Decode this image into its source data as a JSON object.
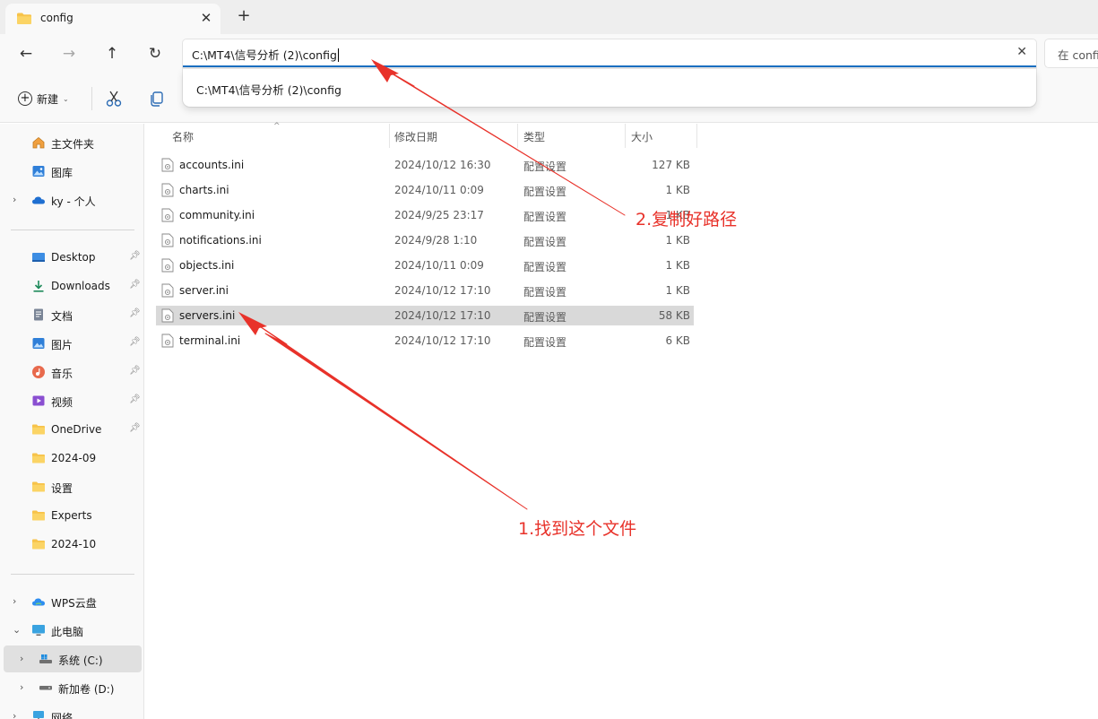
{
  "window": {
    "tab_title": "config",
    "tab_close": "✕",
    "new_tab": "+"
  },
  "nav": {
    "back": "←",
    "forward": "→",
    "up": "↑",
    "refresh": "↻",
    "address": "C:\\MT4\\信号分析 (2)\\config",
    "clear": "✕",
    "search_placeholder": "在 config"
  },
  "toolbar": {
    "new_label": "新建"
  },
  "suggestion": {
    "text": "C:\\MT4\\信号分析 (2)\\config"
  },
  "sidebar": {
    "top_items": [
      {
        "label": "主文件夹",
        "icon": "home-icon"
      },
      {
        "label": "图库",
        "icon": "gallery-icon"
      },
      {
        "label": "ky - 个人",
        "icon": "cloud-icon",
        "expandable": true
      }
    ],
    "quick_access": [
      {
        "label": "Desktop",
        "icon": "desktop-icon",
        "pinned": true
      },
      {
        "label": "Downloads",
        "icon": "download-icon",
        "pinned": true
      },
      {
        "label": "文档",
        "icon": "document-icon",
        "pinned": true
      },
      {
        "label": "图片",
        "icon": "picture-icon",
        "pinned": true
      },
      {
        "label": "音乐",
        "icon": "music-icon",
        "pinned": true
      },
      {
        "label": "视频",
        "icon": "video-icon",
        "pinned": true
      },
      {
        "label": "OneDrive",
        "icon": "folder-icon",
        "pinned": true
      },
      {
        "label": "2024-09",
        "icon": "folder-icon"
      },
      {
        "label": "设置",
        "icon": "folder-icon"
      },
      {
        "label": "Experts",
        "icon": "folder-icon"
      },
      {
        "label": "2024-10",
        "icon": "folder-icon"
      }
    ],
    "bottom_items": [
      {
        "label": "WPS云盘",
        "icon": "wps-cloud-icon",
        "chevron": "›"
      },
      {
        "label": "此电脑",
        "icon": "pc-icon",
        "chevron": "⌄"
      },
      {
        "label": "系统 (C:)",
        "icon": "drive-c-icon",
        "chevron": "›",
        "selected": true
      },
      {
        "label": "新加卷 (D:)",
        "icon": "drive-d-icon",
        "chevron": "›"
      },
      {
        "label": "网络",
        "icon": "network-icon",
        "chevron": "›"
      }
    ]
  },
  "columns": {
    "name": "名称",
    "date": "修改日期",
    "type": "类型",
    "size": "大小"
  },
  "files": [
    {
      "name": "accounts.ini",
      "date": "2024/10/12 16:30",
      "type": "配置设置",
      "size": "127 KB"
    },
    {
      "name": "charts.ini",
      "date": "2024/10/11 0:09",
      "type": "配置设置",
      "size": "1 KB"
    },
    {
      "name": "community.ini",
      "date": "2024/9/25 23:17",
      "type": "配置设置",
      "size": "1 KB"
    },
    {
      "name": "notifications.ini",
      "date": "2024/9/28 1:10",
      "type": "配置设置",
      "size": "1 KB"
    },
    {
      "name": "objects.ini",
      "date": "2024/10/11 0:09",
      "type": "配置设置",
      "size": "1 KB"
    },
    {
      "name": "server.ini",
      "date": "2024/10/12 17:10",
      "type": "配置设置",
      "size": "1 KB"
    },
    {
      "name": "servers.ini",
      "date": "2024/10/12 17:10",
      "type": "配置设置",
      "size": "58 KB",
      "selected": true
    },
    {
      "name": "terminal.ini",
      "date": "2024/10/12 17:10",
      "type": "配置设置",
      "size": "6 KB"
    }
  ],
  "annotations": {
    "step1": "1.找到这个文件",
    "step2": "2.复制好路径",
    "color": "#e8322a"
  },
  "colors": {
    "accent": "#1a6fc1",
    "folder": "#f7c34a",
    "selection": "#d9d9d9"
  }
}
